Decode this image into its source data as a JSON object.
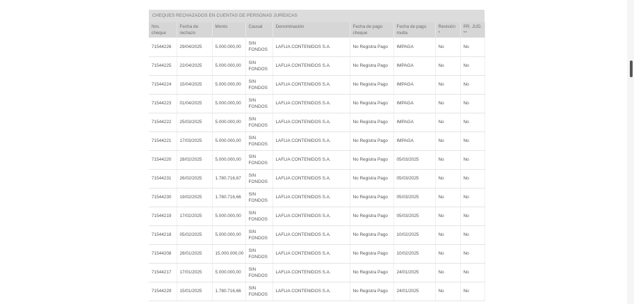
{
  "table": {
    "title": "CHEQUES RECHAZADOS EN CUENTAS DE PERSONAS JURÍDICAS",
    "headers": {
      "nro_cheque": "Nro. cheque",
      "fecha_rechazo": "Fecha de rechazo",
      "monto": "Monto",
      "causal": "Causal",
      "denominacion": "Denominación",
      "fecha_pago_cheque": "Fecha de pago cheque",
      "fecha_pago_multa": "Fecha de pago multa",
      "revision": "Revisión *",
      "pr_jud": "PR. JUD. **"
    },
    "rows": [
      {
        "nro": "71544226",
        "fecha": "29/04/2025",
        "monto": "5.000.000,00",
        "causal": "SIN FONDOS",
        "denominacion": "LAFLIA CONTENIDOS S.A.",
        "pago_cheque": "No Registra Pago",
        "pago_multa": "IMPAGA",
        "revision": "No",
        "prjud": "No"
      },
      {
        "nro": "71544225",
        "fecha": "22/04/2025",
        "monto": "5.000.000,00",
        "causal": "SIN FONDOS",
        "denominacion": "LAFLIA CONTENIDOS S.A.",
        "pago_cheque": "No Registra Pago",
        "pago_multa": "IMPAGA",
        "revision": "No",
        "prjud": "No"
      },
      {
        "nro": "71544224",
        "fecha": "15/04/2025",
        "monto": "5.000.000,00",
        "causal": "SIN FONDOS",
        "denominacion": "LAFLIA CONTENIDOS S.A.",
        "pago_cheque": "No Registra Pago",
        "pago_multa": "IMPAGA",
        "revision": "No",
        "prjud": "No"
      },
      {
        "nro": "71544223",
        "fecha": "01/04/2025",
        "monto": "5.000.000,00",
        "causal": "SIN FONDOS",
        "denominacion": "LAFLIA CONTENIDOS S.A.",
        "pago_cheque": "No Registra Pago",
        "pago_multa": "IMPAGA",
        "revision": "No",
        "prjud": "No"
      },
      {
        "nro": "71544222",
        "fecha": "25/03/2025",
        "monto": "5.000.000,00",
        "causal": "SIN FONDOS",
        "denominacion": "LAFLIA CONTENIDOS S.A.",
        "pago_cheque": "No Registra Pago",
        "pago_multa": "IMPAGA",
        "revision": "No",
        "prjud": "No"
      },
      {
        "nro": "71544221",
        "fecha": "17/03/2025",
        "monto": "5.000.000,00",
        "causal": "SIN FONDOS",
        "denominacion": "LAFLIA CONTENIDOS S.A.",
        "pago_cheque": "No Registra Pago",
        "pago_multa": "IMPAGA",
        "revision": "No",
        "prjud": "No"
      },
      {
        "nro": "71544220",
        "fecha": "28/02/2025",
        "monto": "5.000.000,00",
        "causal": "SIN FONDOS",
        "denominacion": "LAFLIA CONTENIDOS S.A.",
        "pago_cheque": "No Registra Pago",
        "pago_multa": "05/03/2025",
        "revision": "No",
        "prjud": "No"
      },
      {
        "nro": "71544231",
        "fecha": "26/02/2025",
        "monto": "1.780.716,67",
        "causal": "SIN FONDOS",
        "denominacion": "LAFLIA CONTENIDOS S.A.",
        "pago_cheque": "No Registra Pago",
        "pago_multa": "05/03/2025",
        "revision": "No",
        "prjud": "No"
      },
      {
        "nro": "71544230",
        "fecha": "19/02/2025",
        "monto": "1.780.716,66",
        "causal": "SIN FONDOS",
        "denominacion": "LAFLIA CONTENIDOS S.A.",
        "pago_cheque": "No Registra Pago",
        "pago_multa": "05/03/2025",
        "revision": "No",
        "prjud": "No"
      },
      {
        "nro": "71544219",
        "fecha": "17/02/2025",
        "monto": "5.000.000,00",
        "causal": "SIN FONDOS",
        "denominacion": "LAFLIA CONTENIDOS S.A.",
        "pago_cheque": "No Registra Pago",
        "pago_multa": "05/03/2025",
        "revision": "No",
        "prjud": "No"
      },
      {
        "nro": "71544218",
        "fecha": "05/02/2025",
        "monto": "5.000.000,00",
        "causal": "SIN FONDOS",
        "denominacion": "LAFLIA CONTENIDOS S.A.",
        "pago_cheque": "No Registra Pago",
        "pago_multa": "10/02/2025",
        "revision": "No",
        "prjud": "No"
      },
      {
        "nro": "71544208",
        "fecha": "28/01/2025",
        "monto": "15.000.000,00",
        "causal": "SIN FONDOS",
        "denominacion": "LAFLIA CONTENIDOS S.A.",
        "pago_cheque": "No Registra Pago",
        "pago_multa": "10/02/2025",
        "revision": "No",
        "prjud": "No"
      },
      {
        "nro": "71544217",
        "fecha": "17/01/2025",
        "monto": "5.000.000,00",
        "causal": "SIN FONDOS",
        "denominacion": "LAFLIA CONTENIDOS S.A.",
        "pago_cheque": "No Registra Pago",
        "pago_multa": "24/01/2025",
        "revision": "No",
        "prjud": "No"
      },
      {
        "nro": "71544229",
        "fecha": "15/01/2025",
        "monto": "1.780.716,66",
        "causal": "SIN FONDOS",
        "denominacion": "LAFLIA CONTENIDOS S.A.",
        "pago_cheque": "No Registra Pago",
        "pago_multa": "24/01/2025",
        "revision": "No",
        "prjud": "No"
      }
    ]
  }
}
